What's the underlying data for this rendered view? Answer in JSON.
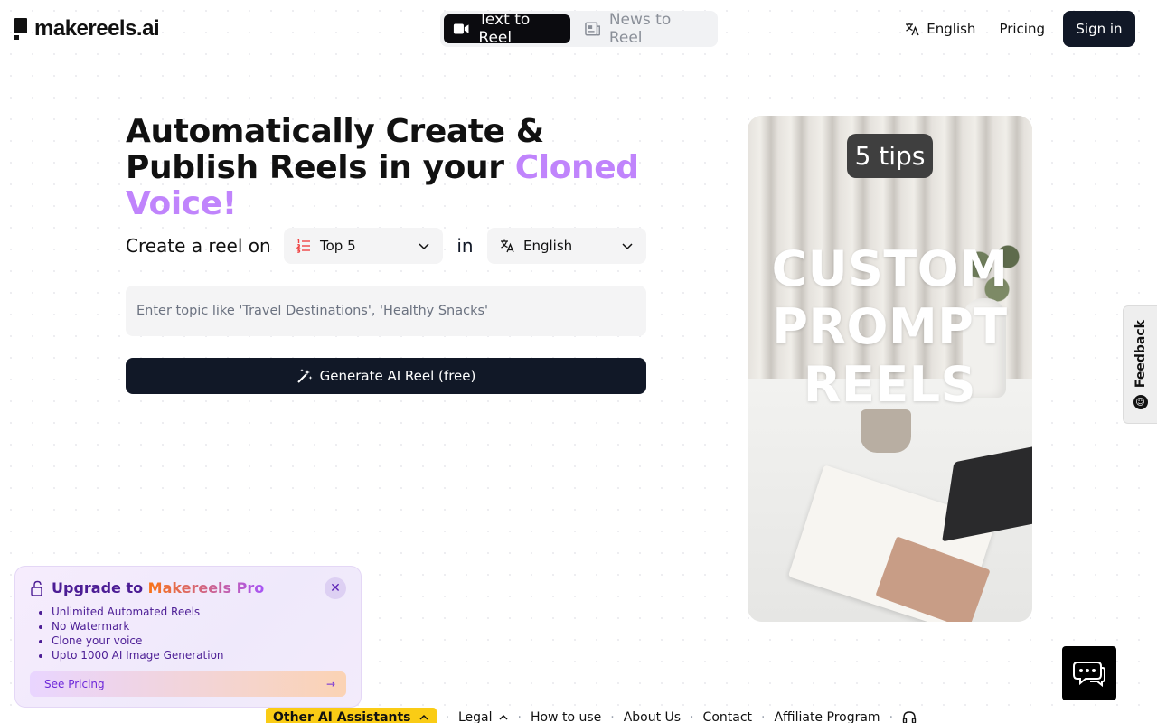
{
  "header": {
    "logo_text": "makereels.ai",
    "tabs": [
      {
        "label": "Text to Reel",
        "active": true
      },
      {
        "label": "News to Reel",
        "active": false
      }
    ],
    "language_label": "English",
    "pricing_label": "Pricing",
    "signin_label": "Sign in"
  },
  "hero": {
    "title_part1": "Automatically Create & Publish Reels in your ",
    "title_accent": "Cloned Voice!",
    "accent_color": "#c084fc",
    "create_label": "Create a reel on",
    "type_select_value": "Top 5",
    "in_label": "in",
    "language_select_value": "English",
    "topic_placeholder": "Enter topic like 'Travel Destinations', 'Healthy Snacks'",
    "generate_label": "Generate AI Reel (free)"
  },
  "preview": {
    "badge": "5 tips",
    "line1": "CUSTOM",
    "line2": "PROMPT",
    "line3": "REELS"
  },
  "feedback": {
    "label": "Feedback"
  },
  "upgrade": {
    "title_prefix": "Upgrade to ",
    "title_brand": "Makereels Pro",
    "features": [
      "Unlimited Automated Reels",
      "No Watermark",
      "Clone your voice",
      "Upto 1000 AI Image Generation"
    ],
    "cta_label": "See Pricing"
  },
  "footer": {
    "other_label": "Other AI Assistants",
    "legal_label": "Legal",
    "how_to_use": "How to use",
    "about_us": "About Us",
    "contact": "Contact",
    "affiliate": "Affiliate Program"
  }
}
